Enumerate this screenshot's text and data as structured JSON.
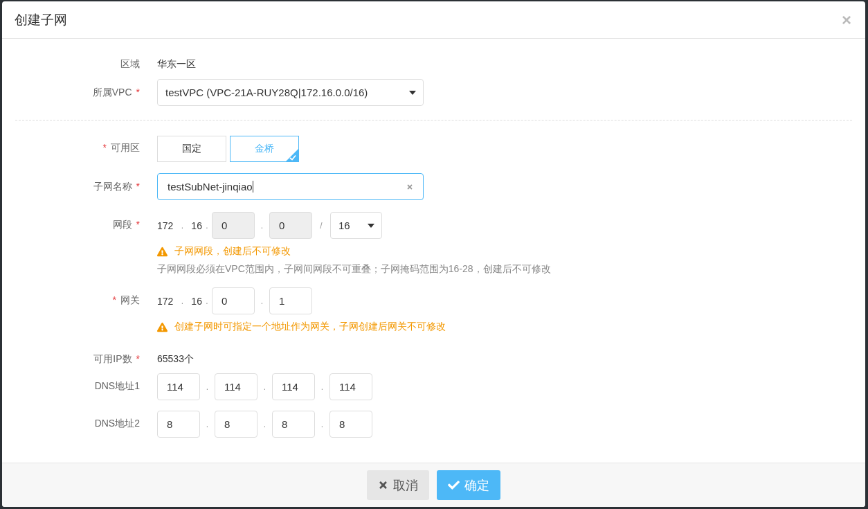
{
  "dialog": {
    "title": "创建子网",
    "close": "×"
  },
  "rows": [
    {
      "kind": "text",
      "label": "区域",
      "value": "华东一区"
    },
    {
      "kind": "select",
      "label": "所属VPC",
      "star_after": "*",
      "value": "testVPC (VPC-21A-RUY28Q|172.16.0.0/16)"
    },
    {
      "kind": "divider"
    },
    {
      "kind": "choice",
      "label": "可用区",
      "star_before": "*",
      "options": [
        {
          "label": "国定",
          "selected": false
        },
        {
          "label": "金桥",
          "selected": true
        }
      ]
    },
    {
      "kind": "input",
      "label": "子网名称",
      "star_after": "*",
      "value": "testSubNet-jinqiao",
      "focused": true
    },
    {
      "kind": "address",
      "label": "网段",
      "star_after": "*",
      "parts": [
        {
          "kind": "text",
          "text": "172"
        },
        {
          "kind": "sep",
          "text": "."
        },
        {
          "kind": "text",
          "text": "16"
        },
        {
          "kind": "sep",
          "text": "."
        },
        {
          "kind": "field",
          "value": "0",
          "disabled": true
        },
        {
          "kind": "sep",
          "text": "."
        },
        {
          "kind": "field",
          "value": "0",
          "disabled": true
        },
        {
          "kind": "sep",
          "text": "/"
        },
        {
          "kind": "select",
          "value": "16"
        }
      ],
      "warning": "子网网段，创建后不可修改",
      "note": "子网网段必须在VPC范围内，子网间网段不可重叠；子网掩码范围为16-28，创建后不可修改"
    },
    {
      "kind": "address",
      "label": "网关",
      "star_before": "*",
      "parts": [
        {
          "kind": "text",
          "text": "172"
        },
        {
          "kind": "sep",
          "text": "."
        },
        {
          "kind": "text",
          "text": "16"
        },
        {
          "kind": "sep",
          "text": "."
        },
        {
          "kind": "field",
          "value": "0",
          "disabled": false
        },
        {
          "kind": "sep",
          "text": "."
        },
        {
          "kind": "field",
          "value": "1",
          "disabled": false
        }
      ],
      "warning": "创建子网时可指定一个地址作为网关，子网创建后网关不可修改"
    },
    {
      "kind": "text",
      "label": "可用IP数",
      "star_after": "*",
      "value": "65533个"
    },
    {
      "kind": "address",
      "label": "DNS地址1",
      "parts": [
        {
          "kind": "field",
          "value": "114",
          "disabled": false
        },
        {
          "kind": "sep",
          "text": "."
        },
        {
          "kind": "field",
          "value": "114",
          "disabled": false
        },
        {
          "kind": "sep",
          "text": "."
        },
        {
          "kind": "field",
          "value": "114",
          "disabled": false
        },
        {
          "kind": "sep",
          "text": "."
        },
        {
          "kind": "field",
          "value": "114",
          "disabled": false
        }
      ]
    },
    {
      "kind": "address",
      "label": "DNS地址2",
      "parts": [
        {
          "kind": "field",
          "value": "8",
          "disabled": false
        },
        {
          "kind": "sep",
          "text": "."
        },
        {
          "kind": "field",
          "value": "8",
          "disabled": false
        },
        {
          "kind": "sep",
          "text": "."
        },
        {
          "kind": "field",
          "value": "8",
          "disabled": false
        },
        {
          "kind": "sep",
          "text": "."
        },
        {
          "kind": "field",
          "value": "8",
          "disabled": false
        }
      ]
    }
  ],
  "buttons": [
    {
      "kind": "cancel",
      "label": "取消"
    },
    {
      "kind": "confirm",
      "label": "确定"
    }
  ]
}
